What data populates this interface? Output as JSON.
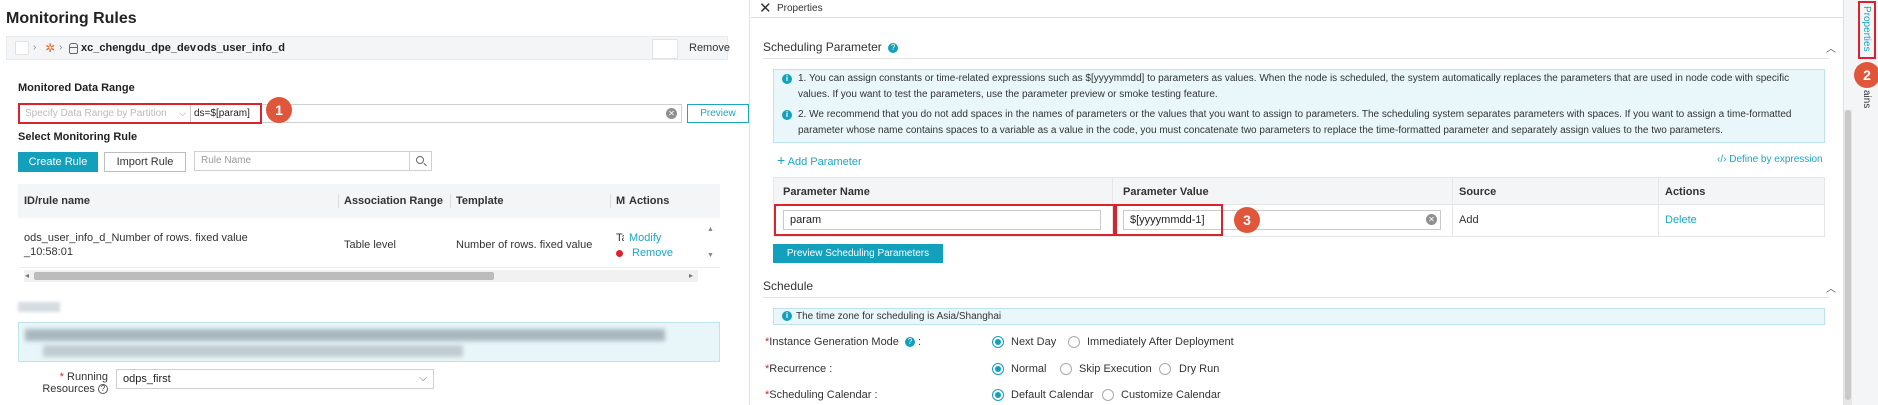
{
  "left": {
    "title": "Monitoring Rules",
    "breadcrumb": {
      "sep": "›",
      "workspace": "xc_chengdu_dpe_dev",
      "table": "ods_user_info_d",
      "remove": "Remove"
    },
    "monitored_range": {
      "label": "Monitored Data Range",
      "select_placeholder": "Specify Data Range by Partition",
      "value": "ds=$[param]",
      "preview": "Preview"
    },
    "monitoring_rule": {
      "label": "Select Monitoring Rule",
      "create": "Create Rule",
      "import": "Import Rule",
      "search_placeholder": "Rule Name"
    },
    "table": {
      "headers": [
        "ID/rule name",
        "Association Range",
        "Template",
        "M",
        "Actions"
      ],
      "row": {
        "name_line1": "ods_user_info_d_Number of rows. fixed value",
        "name_line2": "_10:58:01",
        "range": "Table level",
        "template": "Number of rows. fixed value",
        "partial": "Ta",
        "modify": "Modify",
        "remove": "Remove"
      }
    },
    "resources": {
      "label_line1": "Running",
      "label_line2": "Resources",
      "required": "*",
      "help": "?",
      "value": "odps_first"
    },
    "badge1": "1"
  },
  "right": {
    "header": {
      "title": "Properties"
    },
    "scheduling_parameter": {
      "title": "Scheduling Parameter",
      "info1": "1. You can assign constants or time-related expressions such as $[yyyymmdd] to parameters as values. When the node is scheduled, the system automatically replaces the parameters that are used in node code with specific values. If you want to test the parameters, use the parameter preview or smoke testing feature.",
      "info2": "2. We recommend that you do not add spaces in the names of parameters or the values that you want to assign to parameters. The scheduling system separates parameters with spaces. If you want to assign a time-formatted parameter whose name contains spaces to a variable as a value in the code, you must concatenate two parameters to replace the time-formatted parameter and separately assign values to the two parameters.",
      "add_parameter": "Add Parameter",
      "define_by_expression": "Define by expression",
      "headers": [
        "Parameter Name",
        "Parameter Value",
        "Source",
        "Actions"
      ],
      "row": {
        "name": "param",
        "value": "$[yyyymmdd-1]",
        "source": "Add",
        "action": "Delete"
      },
      "preview_button": "Preview Scheduling Parameters",
      "badge3": "3"
    },
    "schedule": {
      "title": "Schedule",
      "timezone": "The time zone for scheduling is Asia/Shanghai",
      "instance_mode": {
        "label": "Instance Generation Mode",
        "options": [
          "Next Day",
          "Immediately After Deployment"
        ],
        "selected": 0
      },
      "recurrence": {
        "label": "Recurrence :",
        "options": [
          "Normal",
          "Skip Execution",
          "Dry Run"
        ],
        "selected": 0
      },
      "calendar": {
        "label": "Scheduling Calendar :",
        "options": [
          "Default Calendar",
          "Customize Calendar"
        ],
        "selected": 0
      }
    }
  },
  "sidebar": {
    "properties_tab": "Properties",
    "second_tab": "ains",
    "badge2": "2"
  },
  "colors": {
    "accent": "#12a0bd",
    "highlight": "#d9232e",
    "badge": "#e0563b"
  }
}
